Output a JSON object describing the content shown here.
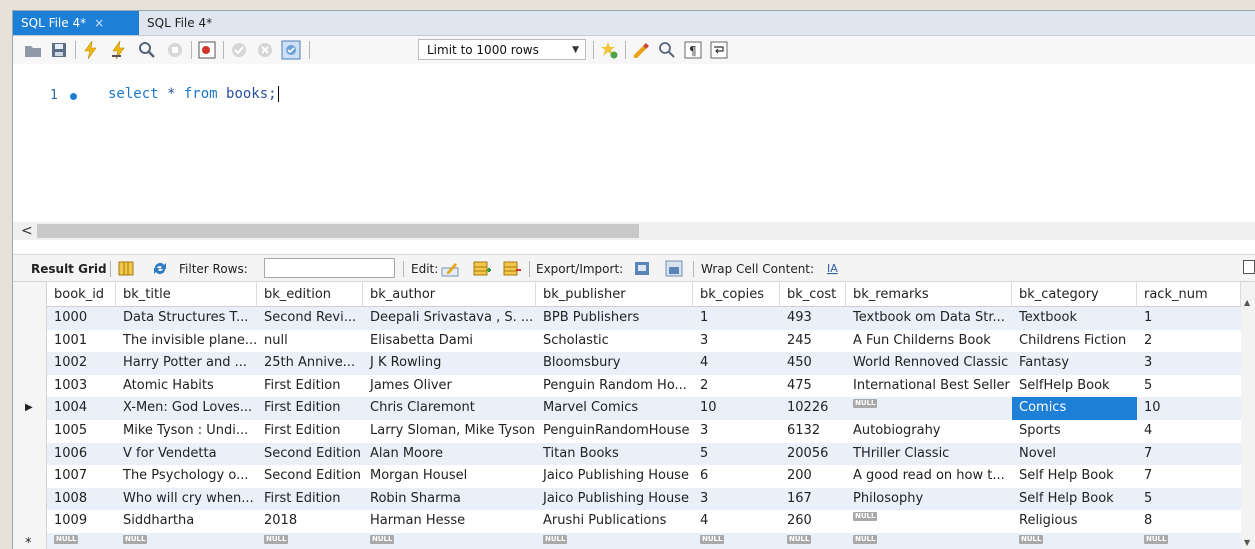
{
  "tabs": [
    {
      "label": "SQL File 4*",
      "close": "×",
      "active": true
    },
    {
      "label": "SQL File 4*",
      "active": false
    }
  ],
  "toolbar": {
    "limit_select": "Limit to 1000 rows",
    "icons": [
      "open-folder-icon",
      "save-icon",
      "execute-icon",
      "execute-current-icon",
      "explain-icon",
      "stop-icon",
      "toggle-error-icon",
      "commit-icon",
      "rollback-icon",
      "autocommit-icon",
      "add-snippet-icon",
      "beautify-icon",
      "find-icon",
      "invisible-chars-icon",
      "word-wrap-icon"
    ]
  },
  "editor": {
    "line_number": "1",
    "kw1": "select",
    "star": " * ",
    "kw2": "from",
    "rest": " books;"
  },
  "scroll": {
    "left_arrow": "<"
  },
  "result_toolbar": {
    "result_grid": "Result Grid",
    "filter_rows": "Filter Rows:",
    "edit": "Edit:",
    "export_import": "Export/Import:",
    "wrap_cell": "Wrap Cell Content:"
  },
  "grid": {
    "columns": [
      "book_id",
      "bk_title",
      "bk_edition",
      "bk_author",
      "bk_publisher",
      "bk_copies",
      "bk_cost",
      "bk_remarks",
      "bk_category",
      "rack_num"
    ],
    "null_label": "NULL",
    "current_row_marker": "▶",
    "new_row_marker": "*",
    "selected_cell": {
      "row": 4,
      "col": 8
    },
    "rows": [
      [
        "1000",
        "Data Structures T...",
        "Second Revi...",
        "Deepali Srivastava , S. ...",
        "BPB Publishers",
        "1",
        "493",
        "Textbook om Data Str...",
        "Textbook",
        "1"
      ],
      [
        "1001",
        "The invisible plane...",
        "null",
        "Elisabetta Dami",
        "Scholastic",
        "3",
        "245",
        "A Fun Childerns Book",
        "Childrens Fiction",
        "2"
      ],
      [
        "1002",
        "Harry Potter and ...",
        "25th Annive...",
        "J K Rowling",
        "Bloomsbury",
        "4",
        "450",
        "World Rennoved Classic",
        "Fantasy",
        "3"
      ],
      [
        "1003",
        "Atomic Habits",
        "First Edition",
        "James Oliver",
        "Penguin Random Ho...",
        "2",
        "475",
        "International Best Seller",
        "SelfHelp Book",
        "5"
      ],
      [
        "1004",
        "X-Men: God Loves...",
        "First Edition",
        "Chris Claremont",
        "Marvel Comics",
        "10",
        "10226",
        null,
        "Comics",
        "10"
      ],
      [
        "1005",
        "Mike Tyson : Undi...",
        "First Edition",
        "Larry Sloman, Mike Tyson",
        "PenguinRandomHouse",
        "3",
        "6132",
        "Autobiograhy",
        "Sports",
        "4"
      ],
      [
        "1006",
        "V for Vendetta",
        "Second Edition",
        "Alan Moore",
        "Titan Books",
        "5",
        "20056",
        "THriller Classic",
        "Novel",
        "7"
      ],
      [
        "1007",
        "The Psychology o...",
        "Second Edition",
        "Morgan Housel",
        "Jaico Publishing House",
        "6",
        "200",
        "A good read on how t...",
        "Self Help Book",
        "7"
      ],
      [
        "1008",
        "Who will cry when...",
        "First Edition",
        "Robin Sharma",
        "Jaico Publishing House",
        "3",
        "167",
        "Philosophy",
        "Self Help Book",
        "5"
      ],
      [
        "1009",
        "Siddhartha",
        "2018",
        "Harman Hesse",
        "Arushi  Publications",
        "4",
        "260",
        null,
        "Religious",
        "8"
      ],
      [
        null,
        null,
        null,
        null,
        null,
        null,
        null,
        null,
        null,
        null
      ]
    ]
  }
}
